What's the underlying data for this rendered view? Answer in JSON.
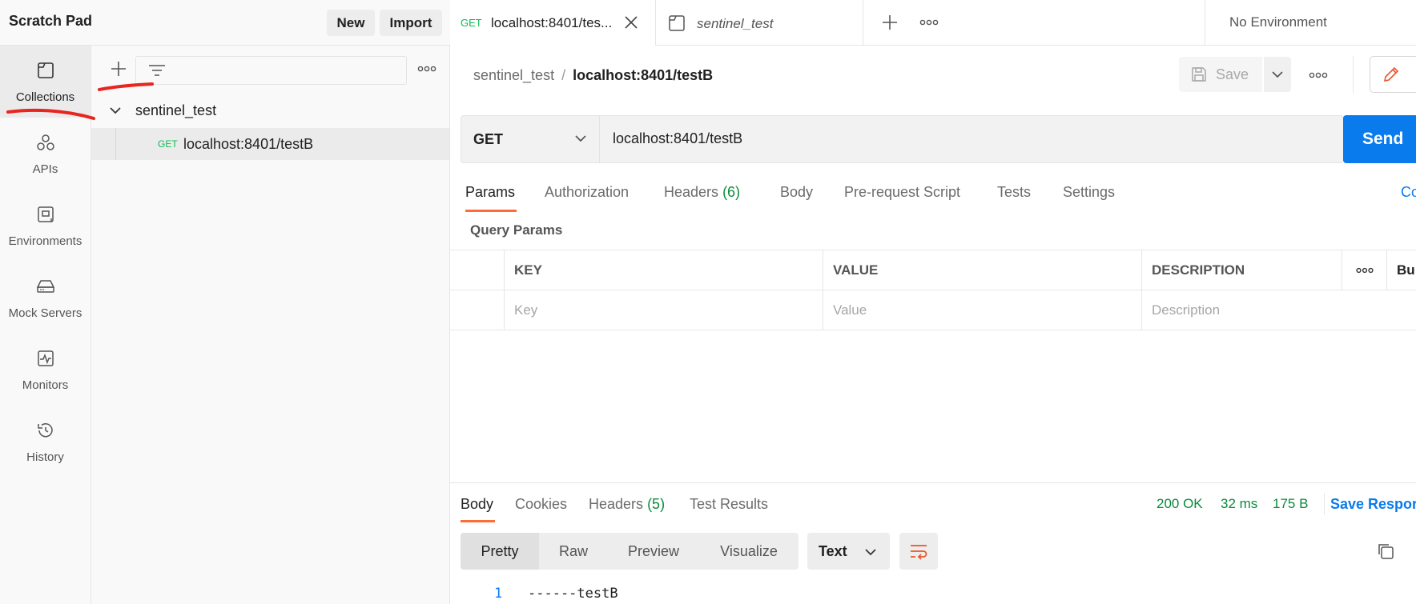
{
  "workspace": {
    "title": "Scratch Pad",
    "new_label": "New",
    "import_label": "Import"
  },
  "nav": {
    "items": [
      {
        "label": "Collections"
      },
      {
        "label": "APIs"
      },
      {
        "label": "Environments"
      },
      {
        "label": "Mock Servers"
      },
      {
        "label": "Monitors"
      },
      {
        "label": "History"
      }
    ]
  },
  "collections": {
    "collection_name": "sentinel_test",
    "request": {
      "method": "GET",
      "name": "localhost:8401/testB"
    }
  },
  "tabs": {
    "active": {
      "method": "GET",
      "title": "localhost:8401/tes..."
    },
    "second": {
      "title": "sentinel_test"
    },
    "environment": "No Environment"
  },
  "breadcrumb": {
    "collection": "sentinel_test",
    "separator": "/",
    "request": "localhost:8401/testB"
  },
  "toolbar": {
    "save_label": "Save"
  },
  "request": {
    "method": "GET",
    "url": "localhost:8401/testB",
    "send_label": "Send",
    "tabs": {
      "params": "Params",
      "authorization": "Authorization",
      "headers": "Headers",
      "headers_count": "(6)",
      "body": "Body",
      "prerequest": "Pre-request Script",
      "tests": "Tests",
      "settings": "Settings",
      "cookies_link": "Co"
    }
  },
  "query_params": {
    "title": "Query Params",
    "headers": {
      "key": "KEY",
      "value": "VALUE",
      "description": "DESCRIPTION",
      "bulk": "Bu"
    },
    "placeholders": {
      "key": "Key",
      "value": "Value",
      "description": "Description"
    }
  },
  "response": {
    "tabs": {
      "body": "Body",
      "cookies": "Cookies",
      "headers": "Headers",
      "headers_count": "(5)",
      "test_results": "Test Results"
    },
    "status": "200 OK",
    "time": "32 ms",
    "size": "175 B",
    "save_label": "Save Respor",
    "formats": {
      "pretty": "Pretty",
      "raw": "Raw",
      "preview": "Preview",
      "visualize": "Visualize"
    },
    "language": "Text",
    "lines": [
      {
        "number": "1",
        "text": "------testB"
      }
    ]
  },
  "colors": {
    "accent": "#ff6c37",
    "primary": "#097bed",
    "success": "#0cbb52",
    "annotation": "#e8251f"
  }
}
